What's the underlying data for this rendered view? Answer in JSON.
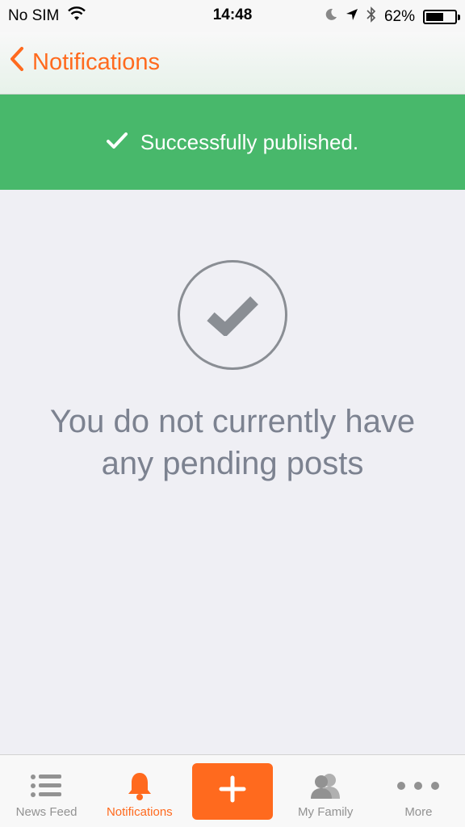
{
  "status_bar": {
    "carrier": "No SIM",
    "time": "14:48",
    "battery_percent": "62%",
    "battery_level": 0.62
  },
  "nav": {
    "title": "Notifications"
  },
  "banner": {
    "message": "Successfully published."
  },
  "empty_state": {
    "message": "You do not currently have any pending posts"
  },
  "tab_bar": {
    "items": [
      {
        "label": "News Feed",
        "icon": "list-icon"
      },
      {
        "label": "Notifications",
        "icon": "bell-icon"
      },
      {
        "label": "",
        "icon": "plus-icon"
      },
      {
        "label": "My Family",
        "icon": "people-icon"
      },
      {
        "label": "More",
        "icon": "ellipsis-icon"
      }
    ]
  },
  "colors": {
    "accent": "#ff6a1e",
    "success": "#48b86b",
    "muted": "#929292"
  }
}
